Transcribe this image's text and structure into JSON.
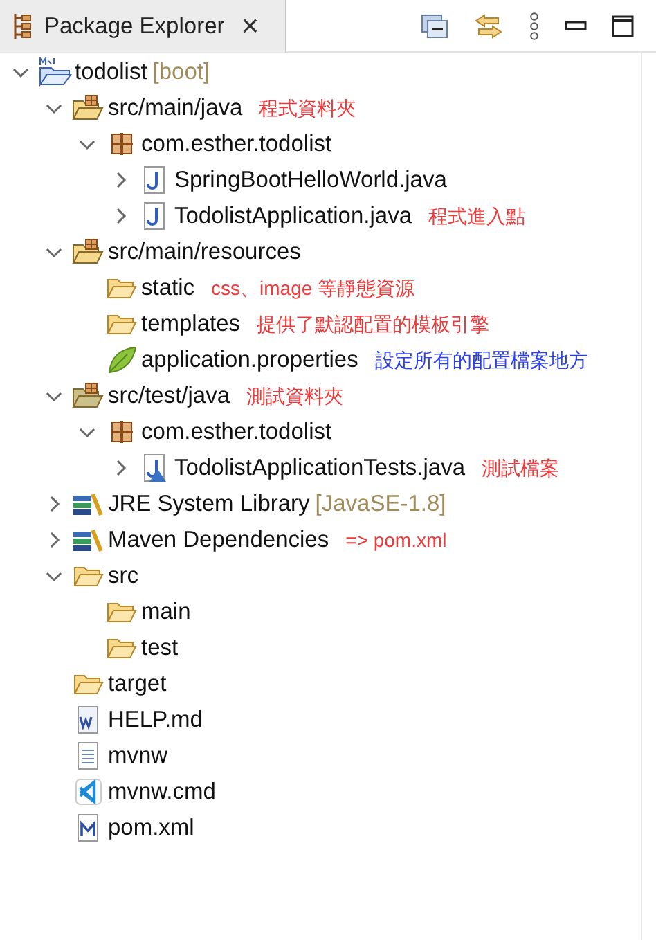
{
  "tab": {
    "title": "Package Explorer",
    "close": "×",
    "selected": true
  },
  "tree": [
    {
      "kind": "project",
      "label": "todolist",
      "suffix": "[boot]",
      "expanded": true,
      "children": [
        {
          "kind": "source-folder",
          "label": "src/main/java",
          "note": {
            "text": "程式資料夾",
            "color": "#f03a3a"
          },
          "expanded": true,
          "children": [
            {
              "kind": "package",
              "label": "com.esther.todolist",
              "expanded": true,
              "children": [
                {
                  "kind": "java",
                  "label": "SpringBootHelloWorld.java",
                  "expanded": false
                },
                {
                  "kind": "java",
                  "label": "TodolistApplication.java",
                  "note": {
                    "text": "程式進入點",
                    "color": "#f03a3a"
                  },
                  "expanded": false
                }
              ]
            }
          ]
        },
        {
          "kind": "source-folder",
          "label": "src/main/resources",
          "expanded": true,
          "children": [
            {
              "kind": "folder",
              "label": "static",
              "note": {
                "text": "css、image 等靜態資源",
                "color": "#f03a3a"
              }
            },
            {
              "kind": "folder",
              "label": "templates",
              "note": {
                "text": "提供了默認配置的模板引擎",
                "color": "#f03a3a"
              }
            },
            {
              "kind": "properties",
              "label": "application.properties",
              "note": {
                "text": "設定所有的配置檔案地方",
                "color": "#2a3ff0"
              }
            }
          ]
        },
        {
          "kind": "test-folder",
          "label": "src/test/java",
          "note": {
            "text": "測試資料夾",
            "color": "#f03a3a"
          },
          "expanded": true,
          "children": [
            {
              "kind": "package",
              "label": "com.esther.todolist",
              "expanded": true,
              "children": [
                {
                  "kind": "test-java",
                  "label": "TodolistApplicationTests.java",
                  "note": {
                    "text": "測試檔案",
                    "color": "#f03a3a"
                  },
                  "expanded": false
                }
              ]
            }
          ]
        },
        {
          "kind": "library",
          "label": "JRE System Library",
          "suffix": "[JavaSE-1.8]",
          "expanded": false
        },
        {
          "kind": "library",
          "label": "Maven Dependencies",
          "note": {
            "text": "=> pom.xml",
            "color": "#f03a3a"
          },
          "expanded": false
        },
        {
          "kind": "folder",
          "label": "src",
          "expanded": true,
          "children": [
            {
              "kind": "folder",
              "label": "main"
            },
            {
              "kind": "folder",
              "label": "test"
            }
          ]
        },
        {
          "kind": "folder",
          "label": "target"
        },
        {
          "kind": "word-file",
          "label": "HELP.md"
        },
        {
          "kind": "text-file",
          "label": "mvnw"
        },
        {
          "kind": "vscode-file",
          "label": "mvnw.cmd"
        },
        {
          "kind": "maven-file",
          "label": "pom.xml"
        }
      ]
    }
  ]
}
